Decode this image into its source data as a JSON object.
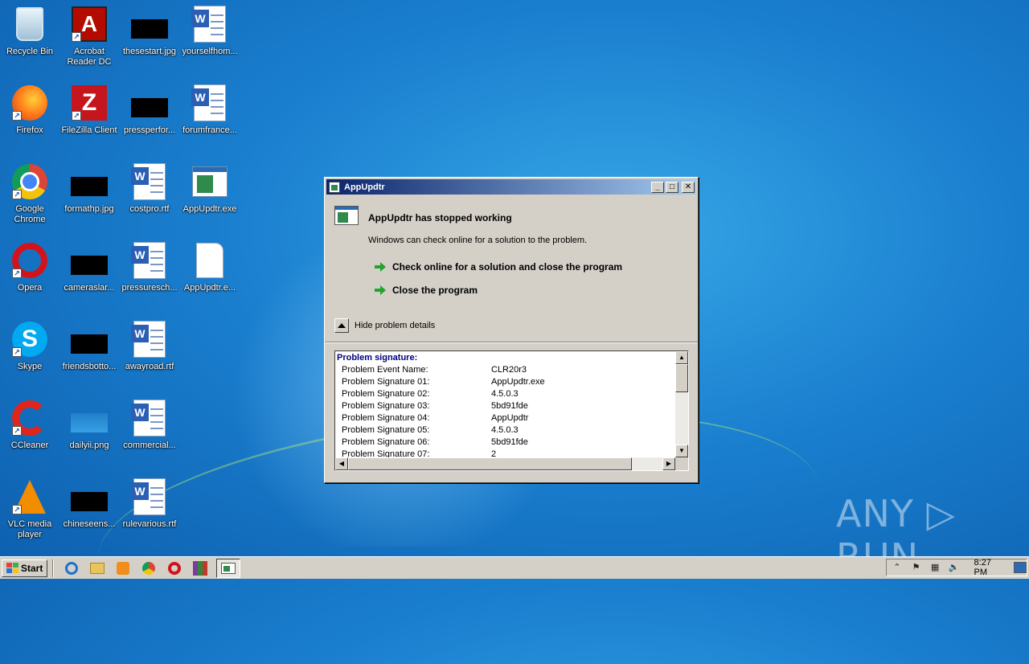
{
  "desktop": {
    "icons": [
      {
        "label": "Recycle Bin"
      },
      {
        "label": "Acrobat Reader DC"
      },
      {
        "label": "thesestart.jpg"
      },
      {
        "label": "yourselfhom..."
      },
      {
        "label": "Firefox"
      },
      {
        "label": "FileZilla Client"
      },
      {
        "label": "pressperfor..."
      },
      {
        "label": "forumfrance..."
      },
      {
        "label": "Google Chrome"
      },
      {
        "label": "formathp.jpg"
      },
      {
        "label": "costpro.rtf"
      },
      {
        "label": "AppUpdtr.exe"
      },
      {
        "label": "Opera"
      },
      {
        "label": "cameraslar..."
      },
      {
        "label": "pressuresch..."
      },
      {
        "label": "AppUpdtr.e..."
      },
      {
        "label": "Skype"
      },
      {
        "label": "friendsbotto..."
      },
      {
        "label": "awayroad.rtf"
      },
      {
        "label": "CCleaner"
      },
      {
        "label": "dailyii.png"
      },
      {
        "label": "commercial..."
      },
      {
        "label": "VLC media player"
      },
      {
        "label": "chineseens..."
      },
      {
        "label": "rulevarious.rtf"
      }
    ]
  },
  "dialog": {
    "title": "AppUpdtr",
    "heading": "AppUpdtr has stopped working",
    "message": "Windows can check online for a solution to the problem.",
    "option_check_online": "Check online for a solution and close the program",
    "option_close": "Close the program",
    "toggle_details": "Hide problem details",
    "details": {
      "title": "Problem signature:",
      "rows": [
        {
          "key": "Problem Event Name:",
          "value": "CLR20r3"
        },
        {
          "key": "Problem Signature 01:",
          "value": "AppUpdtr.exe"
        },
        {
          "key": "Problem Signature 02:",
          "value": "4.5.0.3"
        },
        {
          "key": "Problem Signature 03:",
          "value": "5bd91fde"
        },
        {
          "key": "Problem Signature 04:",
          "value": "AppUpdtr"
        },
        {
          "key": "Problem Signature 05:",
          "value": "4.5.0.3"
        },
        {
          "key": "Problem Signature 06:",
          "value": "5bd91fde"
        },
        {
          "key": "Problem Signature 07:",
          "value": "2"
        }
      ]
    }
  },
  "watermark": "ANY ▷ RUN",
  "taskbar": {
    "start_label": "Start",
    "clock": "8:27 PM"
  }
}
